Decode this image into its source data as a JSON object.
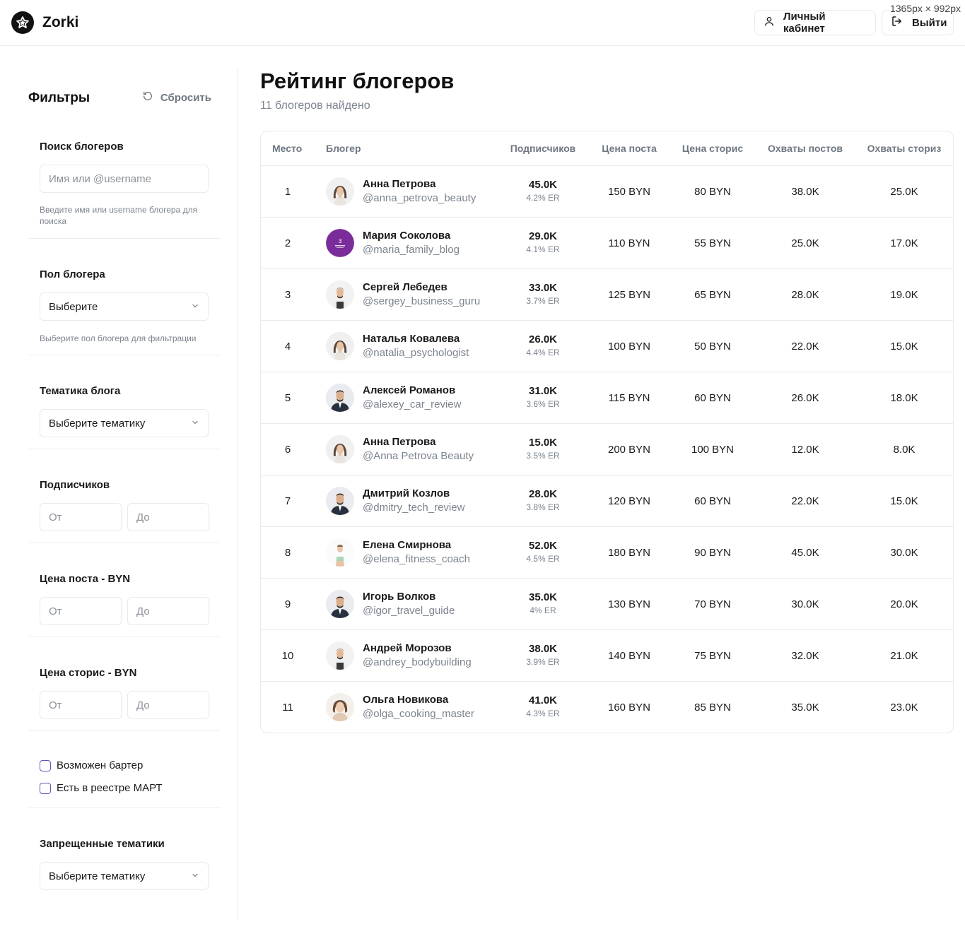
{
  "app": {
    "brand": "Zorki",
    "viewport_label": "1365px × 992px",
    "cabinet_label": "Личный кабинет",
    "logout_label": "Выйти"
  },
  "filters": {
    "title": "Фильтры",
    "reset_label": "Сбросить",
    "search": {
      "label": "Поиск блогеров",
      "placeholder": "Имя или @username",
      "hint": "Введите имя или username блогера для поиска"
    },
    "gender": {
      "label": "Пол блогера",
      "value": "Выберите",
      "hint": "Выберите пол блогера для фильтрации"
    },
    "topic": {
      "label": "Тематика блога",
      "value": "Выберите тематику"
    },
    "subscribers": {
      "label": "Подписчиков",
      "from": "От",
      "to": "До"
    },
    "post_price": {
      "label": "Цена поста - BYN",
      "from": "От",
      "to": "До"
    },
    "story_price": {
      "label": "Цена сторис - BYN",
      "from": "От",
      "to": "До"
    },
    "barter_label": "Возможен бартер",
    "registry_label": "Есть в реестре МАРТ",
    "forbidden": {
      "label": "Запрещенные тематики",
      "value": "Выберите тематику"
    }
  },
  "main": {
    "title": "Рейтинг блогеров",
    "subtitle": "11 блогеров найдено"
  },
  "table": {
    "columns": [
      "Место",
      "Блогер",
      "Подписчиков",
      "Цена поста",
      "Цена сторис",
      "Охваты постов",
      "Охваты сториз"
    ],
    "rows": [
      {
        "place": "1",
        "name": "Анна Петрова",
        "username": "@anna_petrova_beauty",
        "subscribers": "45.0K",
        "er": "4.2% ER",
        "post_price": "150 BYN",
        "story_price": "80 BYN",
        "post_reach": "38.0K",
        "story_reach": "25.0K",
        "avatar": "woman-photo"
      },
      {
        "place": "2",
        "name": "Мария Соколова",
        "username": "@maria_family_blog",
        "subscribers": "29.0K",
        "er": "4.1% ER",
        "post_price": "110 BYN",
        "story_price": "55 BYN",
        "post_reach": "25.0K",
        "story_reach": "17.0K",
        "avatar": "purple-logo"
      },
      {
        "place": "3",
        "name": "Сергей Лебедев",
        "username": "@sergey_business_guru",
        "subscribers": "33.0K",
        "er": "3.7% ER",
        "post_price": "125 BYN",
        "story_price": "65 BYN",
        "post_reach": "28.0K",
        "story_reach": "19.0K",
        "avatar": "man-apron"
      },
      {
        "place": "4",
        "name": "Наталья Ковалева",
        "username": "@natalia_psychologist",
        "subscribers": "26.0K",
        "er": "4.4% ER",
        "post_price": "100 BYN",
        "story_price": "50 BYN",
        "post_reach": "22.0K",
        "story_reach": "15.0K",
        "avatar": "woman-photo"
      },
      {
        "place": "5",
        "name": "Алексей Романов",
        "username": "@alexey_car_review",
        "subscribers": "31.0K",
        "er": "3.6% ER",
        "post_price": "115 BYN",
        "story_price": "60 BYN",
        "post_reach": "26.0K",
        "story_reach": "18.0K",
        "avatar": "man-suit"
      },
      {
        "place": "6",
        "name": "Анна Петрова",
        "username": "@Anna Petrova Beauty",
        "subscribers": "15.0K",
        "er": "3.5% ER",
        "post_price": "200 BYN",
        "story_price": "100 BYN",
        "post_reach": "12.0K",
        "story_reach": "8.0K",
        "avatar": "woman-photo"
      },
      {
        "place": "7",
        "name": "Дмитрий Козлов",
        "username": "@dmitry_tech_review",
        "subscribers": "28.0K",
        "er": "3.8% ER",
        "post_price": "120 BYN",
        "story_price": "60 BYN",
        "post_reach": "22.0K",
        "story_reach": "15.0K",
        "avatar": "man-suit"
      },
      {
        "place": "8",
        "name": "Елена Смирнова",
        "username": "@elena_fitness_coach",
        "subscribers": "52.0K",
        "er": "4.5% ER",
        "post_price": "180 BYN",
        "story_price": "90 BYN",
        "post_reach": "45.0K",
        "story_reach": "30.0K",
        "avatar": "woman-fitness"
      },
      {
        "place": "9",
        "name": "Игорь Волков",
        "username": "@igor_travel_guide",
        "subscribers": "35.0K",
        "er": "4% ER",
        "post_price": "130 BYN",
        "story_price": "70 BYN",
        "post_reach": "30.0K",
        "story_reach": "20.0K",
        "avatar": "man-suit"
      },
      {
        "place": "10",
        "name": "Андрей Морозов",
        "username": "@andrey_bodybuilding",
        "subscribers": "38.0K",
        "er": "3.9% ER",
        "post_price": "140 BYN",
        "story_price": "75 BYN",
        "post_reach": "32.0K",
        "story_reach": "21.0K",
        "avatar": "man-apron"
      },
      {
        "place": "11",
        "name": "Ольга Новикова",
        "username": "@olga_cooking_master",
        "subscribers": "41.0K",
        "er": "4.3% ER",
        "post_price": "160 BYN",
        "story_price": "85 BYN",
        "post_reach": "35.0K",
        "story_reach": "23.0K",
        "avatar": "woman-portrait"
      }
    ]
  },
  "colors": {
    "accent_purple": "#7a2d9a",
    "checkbox_border": "#6b4fb5",
    "muted_text": "#7c848f",
    "border": "#e8eaee"
  },
  "icons": {
    "logo": "star-badge-icon",
    "cabinet": "user-icon",
    "logout": "logout-icon",
    "reset": "refresh-icon",
    "select": "chevron-down-icon"
  }
}
